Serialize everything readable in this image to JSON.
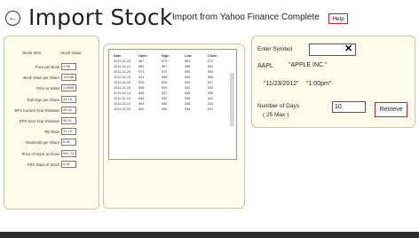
{
  "header": {
    "back_glyph": "←",
    "title": "Import Stock",
    "status": "Import from Yahoo Finance Complete",
    "help_label": "Help"
  },
  "stock_values": {
    "col_item": "Stock Item",
    "col_value": "Stock Value",
    "rows": [
      {
        "label": "Price per Book",
        "value": "4.96"
      },
      {
        "label": "Book Value per Share",
        "value": "125.86"
      },
      {
        "label": "Price to Sales",
        "value": "3.5806"
      },
      {
        "label": "Earnings per Share",
        "value": "44.15"
      },
      {
        "label": "EPS Current Year Estimate",
        "value": "49.32"
      },
      {
        "label": "EPS Next Year Estimate",
        "value": "58.51"
      },
      {
        "label": "PE Ratio",
        "value": "12.76"
      },
      {
        "label": "Dividends per Share",
        "value": "5.30"
      },
      {
        "label": "Price of Stock at Close",
        "value": "561.70"
      },
      {
        "label": "PEG Ratio of Stock",
        "value": "0.56"
      }
    ]
  },
  "history": {
    "headers": [
      "Date",
      "Open",
      "High",
      "Low",
      "Close"
    ],
    "rows": [
      [
        "2012-11-23",
        "567",
        "572",
        "563",
        "572"
      ],
      [
        "2012-11-21",
        "564",
        "567",
        "556",
        "561"
      ],
      [
        "2012-11-20",
        "572",
        "572",
        "555",
        "560"
      ],
      [
        "2012-11-19",
        "541",
        "568",
        "540",
        "566"
      ],
      [
        "2012-11-16",
        "525",
        "530",
        "505",
        "527"
      ],
      [
        "2012-11-15",
        "538",
        "540",
        "522",
        "525"
      ],
      [
        "2012-11-14",
        "546",
        "547",
        "536",
        "536"
      ],
      [
        "2012-11-13",
        "538",
        "550",
        "536",
        "542"
      ],
      [
        "2012-11-12",
        "554",
        "555",
        "538",
        "542"
      ],
      [
        "2012-11-09",
        "540",
        "555",
        "534",
        "547"
      ]
    ]
  },
  "retrieve": {
    "symbol_label": "Enter Symbol",
    "symbol_value": "",
    "clear_glyph": "✕",
    "ticker": "AAPL",
    "company": "\"APPLE INC.\"",
    "date": "\"11/23/2012\"",
    "time": "\"1:00pm\"",
    "days_label_1": "Number of Days",
    "days_label_2": "( 25 Max )",
    "days_value": "10",
    "retrieve_label": "Retrieve"
  },
  "colors": {
    "panel_bg": "#fdfcea",
    "accent_red": "#d42020"
  }
}
